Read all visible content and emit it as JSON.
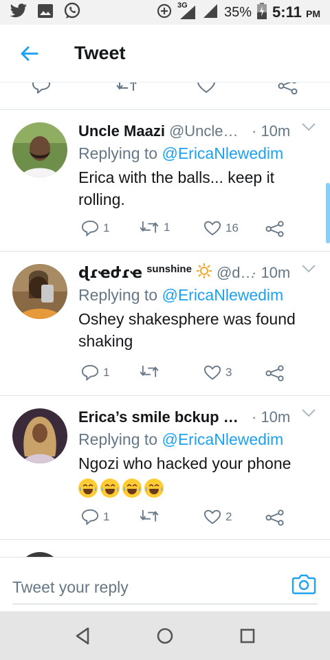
{
  "status_bar": {
    "network": "3G",
    "battery": "35%",
    "time": "5:11",
    "ampm": "PM",
    "icons": [
      "twitter-icon",
      "gallery-icon",
      "whatsapp-icon",
      "data-saver-icon",
      "signal-icon",
      "battery-icon"
    ]
  },
  "header": {
    "title": "Tweet",
    "back_icon": "arrow-left-icon"
  },
  "colors": {
    "accent": "#1da1f2",
    "text": "#14171a",
    "muted": "#657786",
    "divider": "#dfe5ea"
  },
  "tweets": [
    {
      "name": "Uncle Maazi",
      "handle": "@Uncle…",
      "time": "· 10m",
      "replying_prefix": "Replying to",
      "replying_to": "@EricaNlewedim",
      "text": "Erica with the balls... keep it rolling.",
      "replies": "1",
      "retweets": "1",
      "likes": "16"
    },
    {
      "name": "ɖɾҽժɾҽ",
      "name_suffix": "sunshine",
      "handle": "@d…",
      "time": "· 10m",
      "replying_prefix": "Replying to",
      "replying_to": "@EricaNlewedim",
      "text": "Oshey shakesphere was found shaking",
      "replies": "1",
      "retweets": "",
      "likes": "3"
    },
    {
      "name": "Erica’s smile bckup …",
      "handle": "",
      "time": "· 10m",
      "replying_prefix": "Replying to",
      "replying_to": "@EricaNlewedim",
      "text": "Ngozi who hacked your phone",
      "emoji_count": 4,
      "replies": "1",
      "retweets": "",
      "likes": "2"
    }
  ],
  "reply": {
    "placeholder": "Tweet your reply",
    "camera_icon": "camera-icon"
  },
  "nav": {
    "icons": [
      "back-triangle-icon",
      "home-circle-icon",
      "recents-square-icon"
    ]
  }
}
